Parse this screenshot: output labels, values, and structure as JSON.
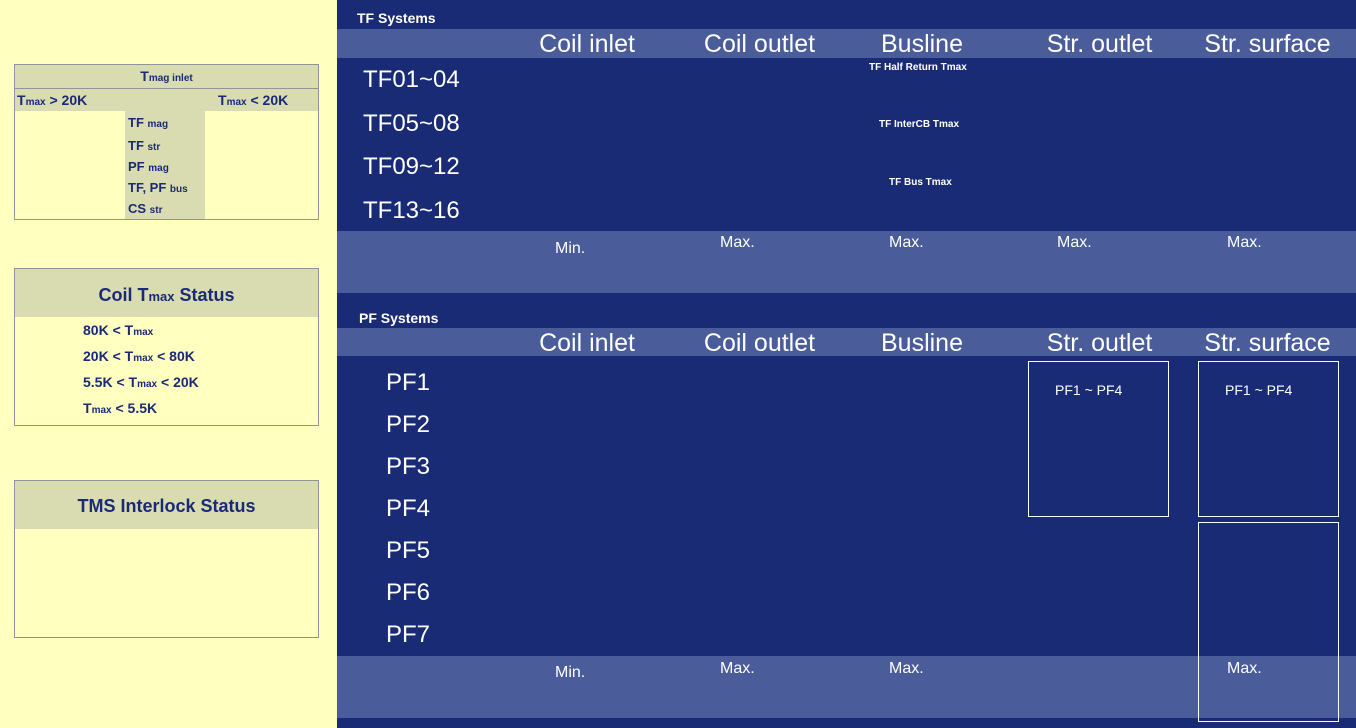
{
  "tmag_panel": {
    "title_main": "T",
    "title_sub": "mag inlet",
    "left_header_main": "T",
    "left_header_sub": "max",
    "left_header_cond": " > 20K",
    "right_header_main": "T",
    "right_header_sub": "max",
    "right_header_cond": " < 20K",
    "items": [
      {
        "main": "TF ",
        "sub": "mag"
      },
      {
        "main": "TF ",
        "sub": "str"
      },
      {
        "main": "PF ",
        "sub": "mag"
      },
      {
        "main": "TF, PF ",
        "sub": "bus"
      },
      {
        "main": "CS ",
        "sub": "str"
      }
    ]
  },
  "coil_status_panel": {
    "title_pre": "Coil T",
    "title_sub": "max",
    "title_post": " Status",
    "rows": [
      {
        "pre": "80K < T",
        "sub": "max",
        "post": ""
      },
      {
        "pre": "20K < T",
        "sub": "max",
        "post": " < 80K"
      },
      {
        "pre": "5.5K < T",
        "sub": "max",
        "post": " < 20K"
      },
      {
        "pre": "T",
        "sub": "max",
        "post": " < 5.5K"
      }
    ]
  },
  "interlock_panel": {
    "title": "TMS Interlock Status"
  },
  "tf_systems": {
    "title": "TF Systems",
    "columns": [
      "Coil inlet",
      "Coil outlet",
      "Busline",
      "Str. outlet",
      "Str. surface"
    ],
    "rows": [
      "TF01~04",
      "TF05~08",
      "TF09~12",
      "TF13~16"
    ],
    "busline_labels": [
      "TF Half Return Tmax",
      "TF InterCB Tmax",
      "TF Bus Tmax"
    ],
    "footer": [
      "Min.",
      "Max.",
      "Max.",
      "Max.",
      "Max."
    ]
  },
  "pf_systems": {
    "title": "PF Systems",
    "columns": [
      "Coil inlet",
      "Coil outlet",
      "Busline",
      "Str. outlet",
      "Str. surface"
    ],
    "rows": [
      "PF1",
      "PF2",
      "PF3",
      "PF4",
      "PF5",
      "PF6",
      "PF7"
    ],
    "str_outlet_box": "PF1 ~ PF4",
    "str_surface_box": "PF1 ~ PF4",
    "footer": [
      "Min.",
      "Max.",
      "Max.",
      "Max."
    ]
  },
  "colors": {
    "background": "#ffffc0",
    "main_panel": "#1a2b76",
    "band": "#4a5c9a",
    "panel_header": "#d8dcb0",
    "panel_text": "#1a2a78"
  }
}
